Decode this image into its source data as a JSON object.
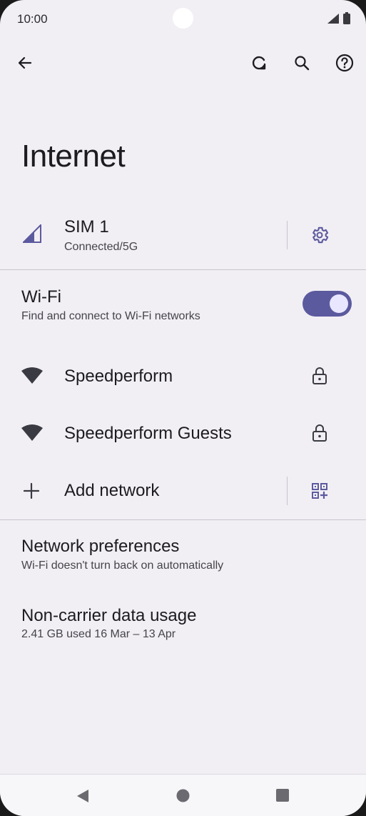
{
  "status_bar": {
    "time": "10:00",
    "icons": [
      "signal-icon",
      "battery-icon"
    ]
  },
  "toolbar": {
    "back_icon": "arrow-left-icon",
    "actions": [
      "refresh-icon",
      "search-icon",
      "help-icon"
    ]
  },
  "page": {
    "title": "Internet"
  },
  "sim": {
    "title": "SIM 1",
    "subtitle": "Connected/5G",
    "settings_icon": "gear-icon"
  },
  "wifi": {
    "title": "Wi-Fi",
    "subtitle": "Find and connect to Wi-Fi networks",
    "enabled": true
  },
  "networks": [
    {
      "name": "Speedperform",
      "icon": "wifi-icon",
      "secure_icon": "lock-icon"
    },
    {
      "name": "Speedperform Guests",
      "icon": "wifi-icon",
      "secure_icon": "lock-icon"
    }
  ],
  "add_network": {
    "label": "Add network",
    "qr_icon": "qr-code-icon"
  },
  "network_preferences": {
    "title": "Network preferences",
    "subtitle": "Wi-Fi doesn't turn back on automatically"
  },
  "non_carrier": {
    "title": "Non-carrier data usage",
    "subtitle": "2.41 GB used 16 Mar – 13 Apr"
  },
  "colors": {
    "accent": "#5c5a9e",
    "background": "#f1eff4",
    "text": "#1c1b20"
  }
}
